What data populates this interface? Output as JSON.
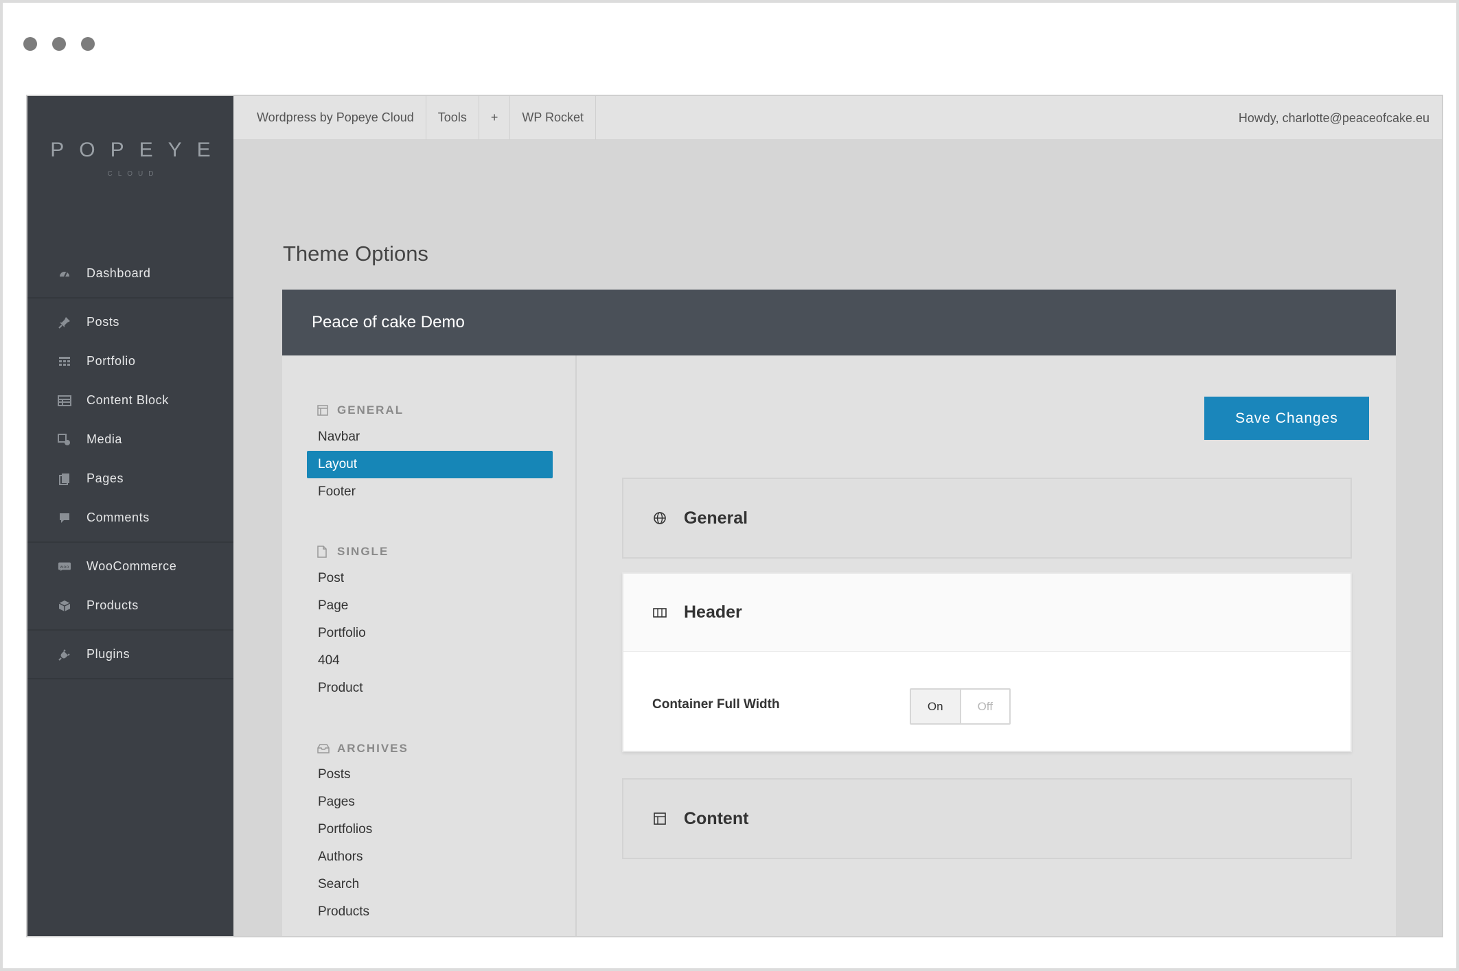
{
  "window": {
    "controls": [
      "close",
      "minimize",
      "maximize"
    ]
  },
  "logo": {
    "main": "POPEYE",
    "sub": "CLOUD"
  },
  "sidebar": {
    "items": [
      {
        "label": "Dashboard",
        "icon": "dashboard-icon"
      },
      {
        "label": "Posts",
        "icon": "pin-icon"
      },
      {
        "label": "Portfolio",
        "icon": "grid-icon"
      },
      {
        "label": "Content Block",
        "icon": "table-icon"
      },
      {
        "label": "Media",
        "icon": "media-icon"
      },
      {
        "label": "Pages",
        "icon": "pages-icon"
      },
      {
        "label": "Comments",
        "icon": "comment-icon"
      },
      {
        "label": "WooCommerce",
        "icon": "woo-icon"
      },
      {
        "label": "Products",
        "icon": "box-icon"
      },
      {
        "label": "Plugins",
        "icon": "plug-icon"
      }
    ]
  },
  "topbar": {
    "items": [
      "Wordpress by Popeye Cloud",
      "Tools",
      "+",
      "WP Rocket"
    ],
    "account": "Howdy, charlotte@peaceofcake.eu"
  },
  "page": {
    "title": "Theme Options"
  },
  "panel": {
    "title": "Peace of cake Demo",
    "sections": {
      "general": {
        "title": "GENERAL",
        "links": [
          "Navbar",
          "Layout",
          "Footer"
        ],
        "active": "Layout"
      },
      "single": {
        "title": "SINGLE",
        "links": [
          "Post",
          "Page",
          "Portfolio",
          "404",
          "Product"
        ]
      },
      "archives": {
        "title": "ARCHIVES",
        "links": [
          "Posts",
          "Pages",
          "Portfolios",
          "Authors",
          "Search",
          "Products"
        ]
      }
    },
    "save_label": "Save Changes",
    "accordions": [
      {
        "title": "General",
        "icon": "globe-icon"
      },
      {
        "title": "Header",
        "icon": "columns-icon",
        "open": true,
        "field": {
          "label": "Container Full Width",
          "on": "On",
          "off": "Off",
          "value": "On"
        }
      },
      {
        "title": "Content",
        "icon": "layout-icon"
      }
    ]
  },
  "colors": {
    "accent": "#1686b7",
    "sidebar": "#3b3f45",
    "panel_header": "#4a5058"
  }
}
